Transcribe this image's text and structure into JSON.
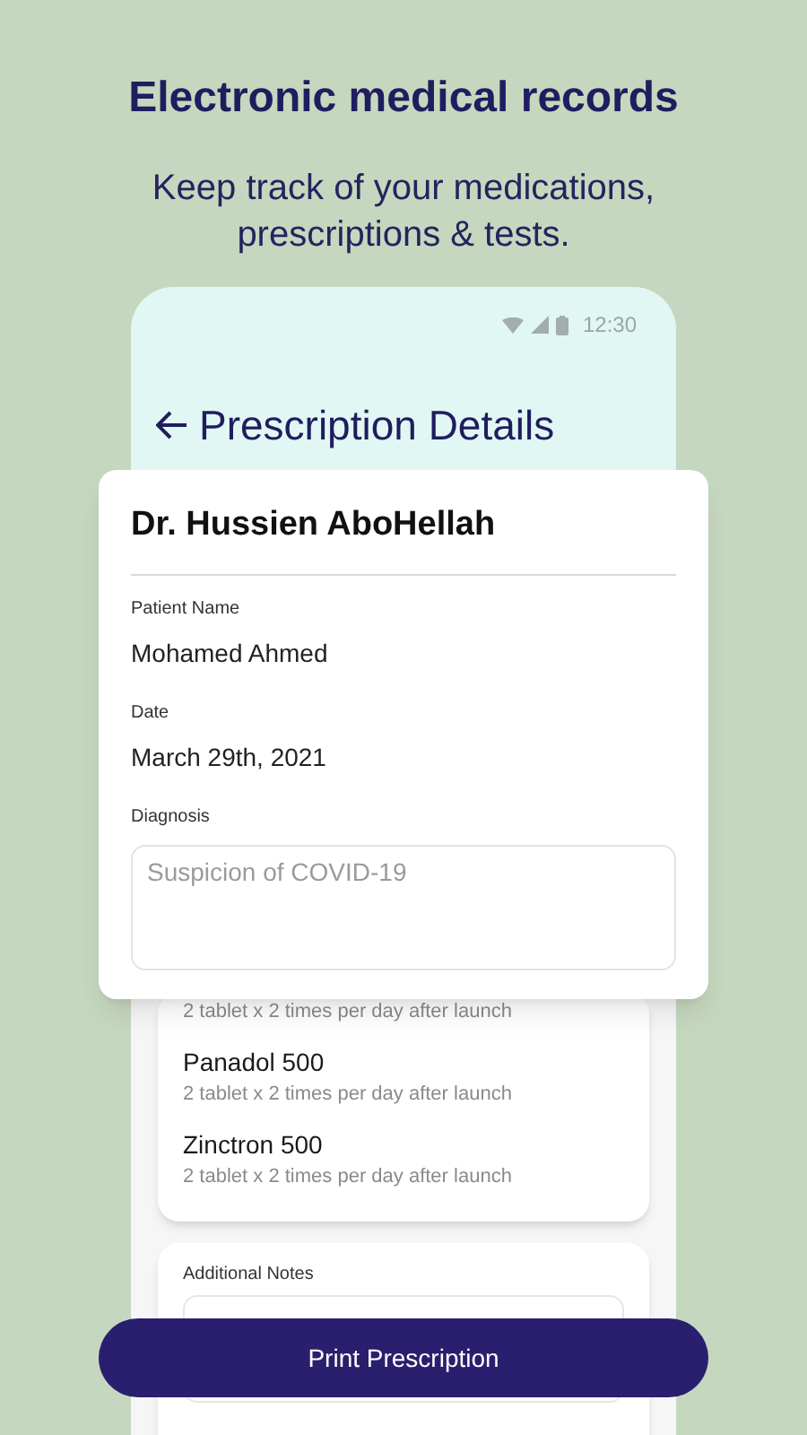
{
  "headline": "Electronic medical records",
  "subtitle": "Keep track of your medications, prescriptions & tests.",
  "status_bar": {
    "time": "12:30"
  },
  "screen_title": "Prescription Details",
  "prescription": {
    "doctor": "Dr. Hussien AboHellah",
    "fields": [
      {
        "label": "Patient Name",
        "value": "Mohamed Ahmed"
      },
      {
        "label": "Date",
        "value": "March 29th, 2021"
      }
    ],
    "diagnosis": {
      "label": "Diagnosis",
      "placeholder": "Suspicion of COVID-19"
    }
  },
  "medications": [
    {
      "dosage": "2 tablet x 2 times per day after launch"
    },
    {
      "name": "Panadol 500",
      "dosage": "2 tablet x 2 times per day after launch"
    },
    {
      "name": "Zinctron 500",
      "dosage": "2 tablet x 2 times per day after launch"
    }
  ],
  "notes": {
    "label": "Additional Notes"
  },
  "button": "Print Prescription"
}
